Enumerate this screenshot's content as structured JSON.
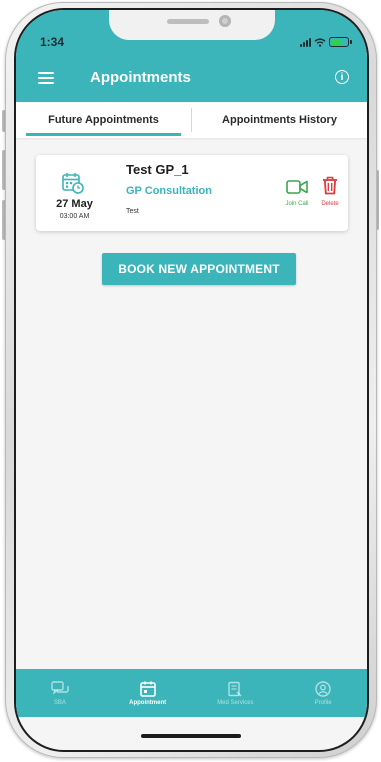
{
  "status_bar": {
    "time": "1:34",
    "battery_level": 0.7
  },
  "header": {
    "title": "Appointments"
  },
  "tabs": [
    {
      "label": "Future Appointments",
      "active": true
    },
    {
      "label": "Appointments History",
      "active": false
    }
  ],
  "appointment": {
    "title": "Test GP_1",
    "type": "GP Consultation",
    "note": "Test",
    "date": "27 May",
    "time": "03:00 AM",
    "join_label": "Join Call",
    "delete_label": "Delete"
  },
  "book_button": {
    "label": "BOOK NEW APPOINTMENT"
  },
  "bottom_nav": [
    {
      "label": "SBA",
      "icon": "chat-icon",
      "active": false
    },
    {
      "label": "Appointment",
      "icon": "calendar-icon",
      "active": true
    },
    {
      "label": "Med Services",
      "icon": "clipboard-icon",
      "active": false
    },
    {
      "label": "Profile",
      "icon": "profile-icon",
      "active": false
    }
  ],
  "colors": {
    "primary": "#3bb4ba",
    "join": "#3aa84e",
    "delete": "#e03b3b"
  }
}
